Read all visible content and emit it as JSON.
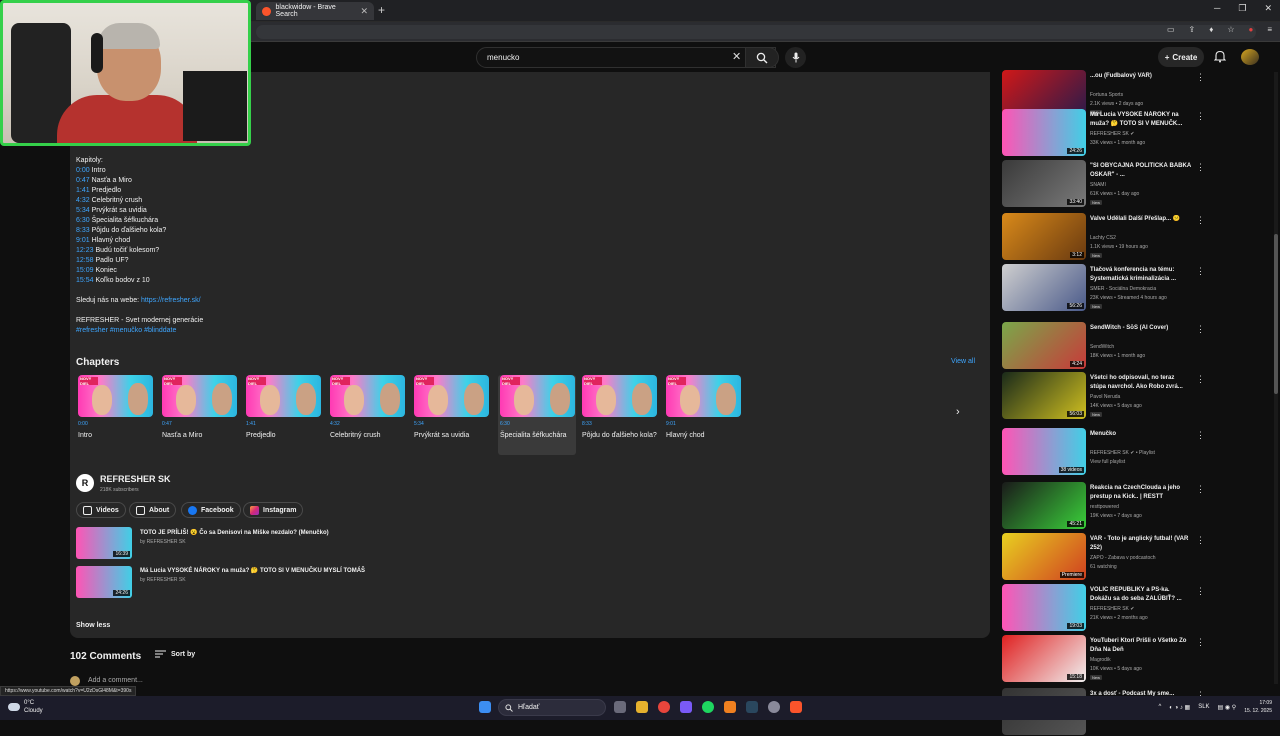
{
  "browser": {
    "tab_title": "blackwidow - Brave Search",
    "new_tab_icon": "plus-icon",
    "status_url": "https://www.youtube.com/watch?v=U2zDsGl48M&t=390s"
  },
  "header": {
    "search_value": "menucko",
    "create_label": "Create"
  },
  "description": {
    "chapters_heading": "Kapitoly:",
    "chapters": [
      {
        "time": "0:00",
        "label": "Intro"
      },
      {
        "time": "0:47",
        "label": "Nasťa a Miro"
      },
      {
        "time": "1:41",
        "label": "Predjedlo"
      },
      {
        "time": "4:32",
        "label": "Celebritný crush"
      },
      {
        "time": "5:34",
        "label": "Prvýkrát sa uvidia"
      },
      {
        "time": "6:30",
        "label": "Špecialita šéfkuchára"
      },
      {
        "time": "8:33",
        "label": "Pôjdu do ďalšieho kola?"
      },
      {
        "time": "9:01",
        "label": "Hlavný chod"
      },
      {
        "time": "12:23",
        "label": "Budú točiť kolesom?"
      },
      {
        "time": "12:58",
        "label": "Padlo UF?"
      },
      {
        "time": "15:09",
        "label": "Koniec"
      },
      {
        "time": "15:54",
        "label": "Koľko bodov z 10"
      }
    ],
    "web_prefix": "Sleduj nás na webe: ",
    "web_link": "https://refresher.sk/",
    "tagline": "REFRESHER - Svet modernej generácie",
    "hashtags": "#refresher #menučko #blinddate"
  },
  "chapter_carousel": {
    "title": "Chapters",
    "view_all": "View all",
    "items": [
      {
        "time": "0:00",
        "label": "Intro"
      },
      {
        "time": "0:47",
        "label": "Nasťa a Miro"
      },
      {
        "time": "1:41",
        "label": "Predjedlo"
      },
      {
        "time": "4:32",
        "label": "Celebritný crush"
      },
      {
        "time": "5:34",
        "label": "Prvýkrát sa uvidia"
      },
      {
        "time": "6:30",
        "label": "Špecialita šéfkuchára"
      },
      {
        "time": "8:33",
        "label": "Pôjdu do ďalšieho kola?"
      },
      {
        "time": "9:01",
        "label": "Hlavný chod"
      }
    ],
    "thumb_badge": "NOVÝ DIEL"
  },
  "channel": {
    "name": "REFRESHER SK",
    "subscribers": "218K subscribers",
    "buttons": [
      "Videos",
      "About",
      "Facebook",
      "Instagram"
    ]
  },
  "related": [
    {
      "title": "TOTO JE PRÍLIŠ! 😮 Čo sa Denisovi na Miške nezdalo? (Menučko)",
      "channel": "by REFRESHER SK",
      "duration": "16:39"
    },
    {
      "title": "Má Lucia VYSOKÉ NÁROKY na muža? 🤔 TOTO SI V MENUČKU MYSLÍ TOMÁŠ",
      "channel": "by REFRESHER SK",
      "duration": "24:26"
    }
  ],
  "show_less": "Show less",
  "comments": {
    "count": "102 Comments",
    "sort_label": "Sort by",
    "add_placeholder": "Add a comment..."
  },
  "sidebar": [
    {
      "title": "...ou (Fudbalový VAR)",
      "channel": "Fortuna Sports",
      "meta": "2.1K views • 2 days ago",
      "badge": "New",
      "duration": "29:37",
      "bg": "linear-gradient(135deg,#d01818,#2a1a4a)"
    },
    {
      "title": "Má Lucia VYSOKÉ NÁROKY na muža? 🤔 TOTO SI V MENUČK...",
      "channel": "REFRESHER SK ✔",
      "meta": "33K views • 1 month ago",
      "badge": "",
      "duration": "24:26",
      "bg": "linear-gradient(90deg,#ff54b5,#40cfe6)"
    },
    {
      "title": "\"SI OBYČAJNÁ POLITICKÁ BÁBKA OSKAR\" - ...",
      "channel": "SNAMI",
      "meta": "61K views • 1 day ago",
      "badge": "New",
      "duration": "33:40",
      "bg": "linear-gradient(135deg,#3a3a3a,#7a7a7a)"
    },
    {
      "title": "Valve Udělali Další Přešlap... 😕",
      "channel": "Lachty CS2",
      "meta": "1.1K views • 19 hours ago",
      "badge": "New",
      "duration": "3:12",
      "bg": "linear-gradient(135deg,#d98a1a,#6a3a10)"
    },
    {
      "title": "Tlačová konferencia na tému: Systematická kriminalizácia ...",
      "channel": "SMER - Sociálna Demokracia",
      "meta": "23K views • Streamed 4 hours ago",
      "badge": "New",
      "duration": "56:26",
      "bg": "linear-gradient(135deg,#cfcfcf,#4a5a8a)"
    },
    {
      "title": "SendWitch - SōS (AI Cover)",
      "channel": "SendWitch",
      "meta": "18K views • 1 month ago",
      "badge": "",
      "duration": "4:24",
      "bg": "linear-gradient(135deg,#7aa84a,#c83a3a)"
    },
    {
      "title": "Všetci ho odpisovali, no teraz stúpa navrchol. Ako Robo zvrá...",
      "channel": "Pavol Neruda",
      "meta": "14K views • 5 days ago",
      "badge": "New",
      "duration": "56:03",
      "bg": "linear-gradient(135deg,#1a2a1a,#d0c020)"
    },
    {
      "title": "Menučko",
      "channel": "REFRESHER SK ✔ • Playlist",
      "meta": "View full playlist",
      "badge": "",
      "duration": "38 videos",
      "bg": "linear-gradient(90deg,#ff54b5,#40cfe6)"
    },
    {
      "title": "Reakcia na CzechClouda a jeho prestup na Kick.. | RESTT",
      "channel": "resttpowered",
      "meta": "19K views • 7 days ago",
      "badge": "",
      "duration": "45:21",
      "bg": "linear-gradient(135deg,#1a1a1a,#3ad03a)"
    },
    {
      "title": "VAR - Toto je anglický futbal! (VAR 252)",
      "channel": "ZAPO - Zabava v podcastoch",
      "meta": "61 watching",
      "badge": "",
      "duration": "Premiere",
      "bg": "linear-gradient(135deg,#e8d020,#d04020)"
    },
    {
      "title": "VOLIČ REPUBLIKY a PS-ka. Dokážu sa do seba ZALÚBIŤ? ...",
      "channel": "REFRESHER SK ✔",
      "meta": "21K views • 2 months ago",
      "badge": "",
      "duration": "19:03",
      "bg": "linear-gradient(90deg,#ff54b5,#40cfe6)"
    },
    {
      "title": "YouTuberi Ktorí Prišli o Všetko Zo Dňa Na Deň",
      "channel": "Magrodik",
      "meta": "10K views • 5 days ago",
      "badge": "New",
      "duration": "15:18",
      "bg": "linear-gradient(135deg,#e02020,#f0f0f0)"
    },
    {
      "title": "3x a dosť - Podcast My sme...",
      "channel": "",
      "meta": "",
      "badge": "",
      "duration": "",
      "bg": "linear-gradient(135deg,#333,#555)"
    }
  ],
  "taskbar": {
    "weather_temp": "0°C",
    "weather_desc": "Cloudy",
    "search_placeholder": "Hľadať",
    "lang": "SLK",
    "time": "17:09",
    "date": "15. 12. 2025"
  }
}
